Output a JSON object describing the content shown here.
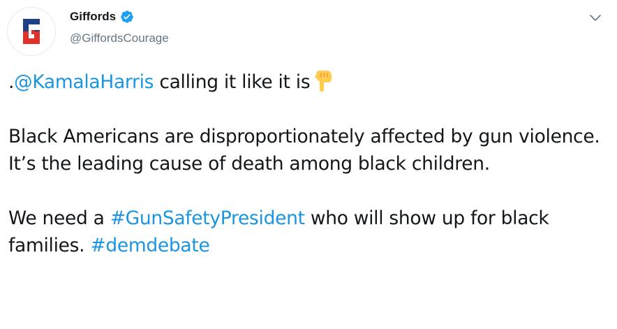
{
  "tweet": {
    "author": {
      "name": "Giffords",
      "handle": "@GiffordsCourage",
      "verified": true,
      "avatar_icon": "giffords-logo",
      "avatar_letter": "G"
    },
    "menu_icon": "chevron-down-icon",
    "paragraph1": {
      "prefix": ".",
      "mention": "@KamalaHarris",
      "text": " calling it like it is",
      "emoji": "backhand-index-pointing-down"
    },
    "paragraph2": {
      "text": "Black Americans are disproportionately affected by gun violence. It’s the leading cause of death among black children."
    },
    "paragraph3": {
      "text1": "We need a ",
      "hashtag1": "#GunSafetyPresident",
      "text2": " who will show up for black families. ",
      "hashtag2": "#demdebate"
    }
  },
  "colors": {
    "link": "#1b95e0",
    "text": "#14171a",
    "secondary": "#657786",
    "verified": "#1da1f2",
    "logo_blue": "#1f3f86",
    "logo_red": "#e2312a"
  }
}
